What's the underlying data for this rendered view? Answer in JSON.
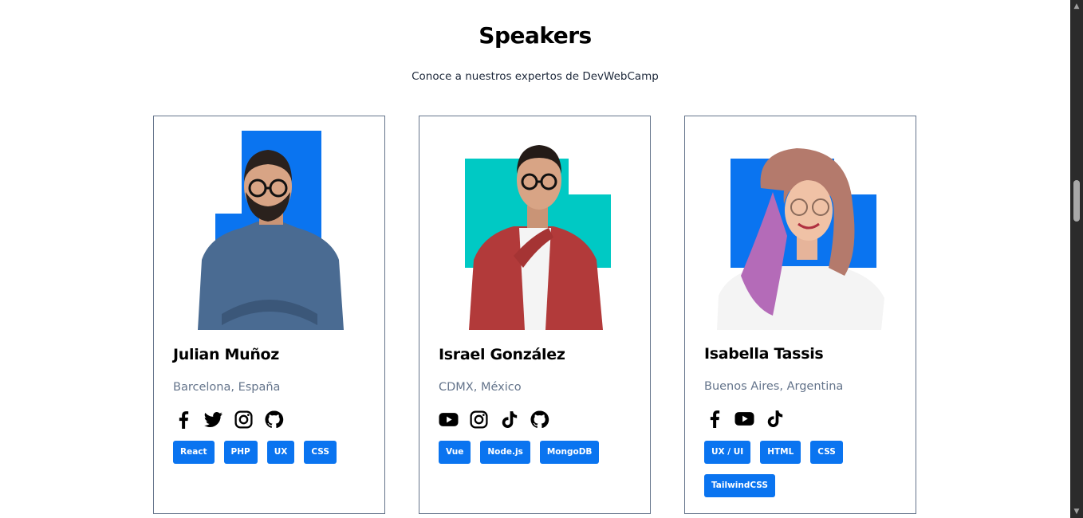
{
  "header": {
    "title": "Speakers",
    "subtitle": "Conoce a nuestros expertos de DevWebCamp"
  },
  "colors": {
    "accent_blue": "#0a74f0",
    "accent_teal": "#00c9c4",
    "muted_text": "#64748b"
  },
  "speakers": [
    {
      "name": "Julian Muñoz",
      "location": "Barcelona, España",
      "socials": [
        "facebook-icon",
        "twitter-icon",
        "instagram-icon",
        "github-icon"
      ],
      "tags": [
        "React",
        "PHP",
        "UX",
        "CSS"
      ]
    },
    {
      "name": "Israel González",
      "location": "CDMX, México",
      "socials": [
        "youtube-icon",
        "instagram-icon",
        "tiktok-icon",
        "github-icon"
      ],
      "tags": [
        "Vue",
        "Node.js",
        "MongoDB"
      ]
    },
    {
      "name": "Isabella Tassis",
      "location": "Buenos Aires, Argentina",
      "socials": [
        "facebook-icon",
        "youtube-icon",
        "tiktok-icon"
      ],
      "tags": [
        "UX / UI",
        "HTML",
        "CSS",
        "TailwindCSS"
      ]
    }
  ]
}
